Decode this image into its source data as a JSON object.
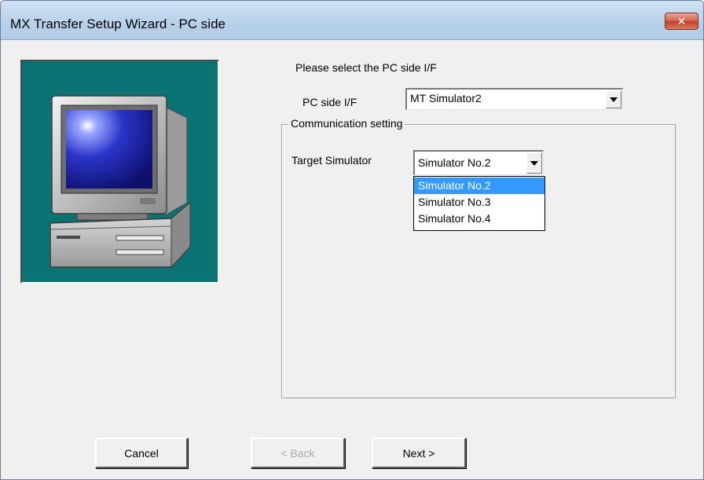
{
  "window": {
    "title": "MX Transfer Setup Wizard - PC side",
    "close_glyph": "✕"
  },
  "prompt": "Please select the PC side I/F",
  "pc_side_if": {
    "label": "PC side I/F",
    "value": "MT Simulator2"
  },
  "communication": {
    "legend": "Communication setting",
    "target_label": "Target Simulator",
    "target_value": "Simulator No.2",
    "options": [
      "Simulator No.2",
      "Simulator No.3",
      "Simulator No.4"
    ],
    "selected_option": "Simulator No.2"
  },
  "buttons": {
    "cancel": "Cancel",
    "back": "< Back",
    "next": "Next >"
  },
  "colors": {
    "illustration_bg": "#0a7474",
    "selection": "#3399ff"
  },
  "icons": {
    "illustration": "computer-illustration",
    "close": "close-icon",
    "dropdown": "chevron-down-icon"
  }
}
